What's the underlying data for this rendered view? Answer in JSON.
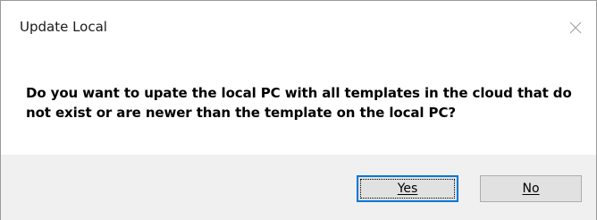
{
  "dialog": {
    "title": "Update Local",
    "message": "Do you want to upate the local PC with all templates in the cloud that do not exist or are newer than the template on the local PC?",
    "close_icon": "close-icon"
  },
  "buttons": {
    "yes_label": "Yes",
    "no_label": "No"
  },
  "colors": {
    "default_button_border": "#0078d7",
    "button_face": "#e1e1e1",
    "button_area_bg": "#f0f0f0"
  }
}
